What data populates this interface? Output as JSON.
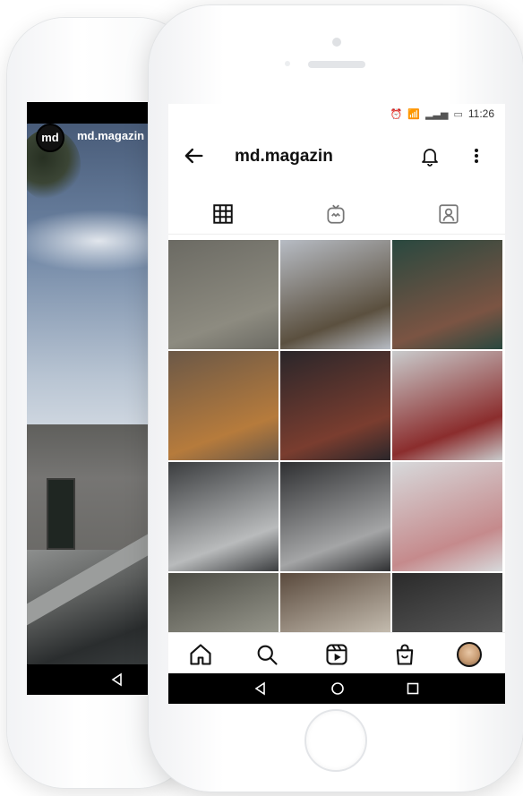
{
  "back_phone": {
    "username": "md.magazin",
    "avatar_text": "md"
  },
  "front_phone": {
    "status_bar": {
      "time": "11:26"
    },
    "header": {
      "title": "md.magazin"
    },
    "tabs": [
      {
        "icon": "grid-icon",
        "selected": true
      },
      {
        "icon": "igtv-icon",
        "selected": false
      },
      {
        "icon": "tagged-icon",
        "selected": false
      }
    ],
    "grid": {
      "rows": 4,
      "cols": 3,
      "tiles": [
        {
          "name": "post-tile-1",
          "colors": [
            "#6b6a63",
            "#8d8b80"
          ]
        },
        {
          "name": "post-tile-2",
          "colors": [
            "#b7bcc4",
            "#5b503f"
          ]
        },
        {
          "name": "post-tile-3",
          "colors": [
            "#29483f",
            "#7b5443"
          ]
        },
        {
          "name": "post-tile-4",
          "colors": [
            "#6b5847",
            "#b67b3c"
          ]
        },
        {
          "name": "post-tile-5",
          "colors": [
            "#2a262a",
            "#7a3d2f"
          ]
        },
        {
          "name": "post-tile-6",
          "colors": [
            "#c9cbcc",
            "#8b2d2d"
          ]
        },
        {
          "name": "post-tile-7",
          "colors": [
            "#3b3d3f",
            "#b9bbbc"
          ]
        },
        {
          "name": "post-tile-8",
          "colors": [
            "#2f3032",
            "#a4a5a6"
          ]
        },
        {
          "name": "post-tile-9",
          "colors": [
            "#d7d9db",
            "#c58a8c"
          ]
        },
        {
          "name": "post-tile-10",
          "colors": [
            "#4a4a43",
            "#9a9a8f"
          ]
        },
        {
          "name": "post-tile-11",
          "colors": [
            "#5a4a3d",
            "#c9c1b4"
          ]
        },
        {
          "name": "post-tile-12",
          "colors": [
            "#2a2a2a",
            "#5b5b5b"
          ]
        }
      ]
    },
    "bottom_nav": [
      {
        "icon": "home-icon"
      },
      {
        "icon": "search-icon"
      },
      {
        "icon": "reels-icon"
      },
      {
        "icon": "shop-icon"
      },
      {
        "icon": "profile-avatar"
      }
    ],
    "system_nav": [
      {
        "icon": "back-triangle-icon"
      },
      {
        "icon": "home-circle-icon"
      },
      {
        "icon": "recent-square-icon"
      }
    ]
  }
}
